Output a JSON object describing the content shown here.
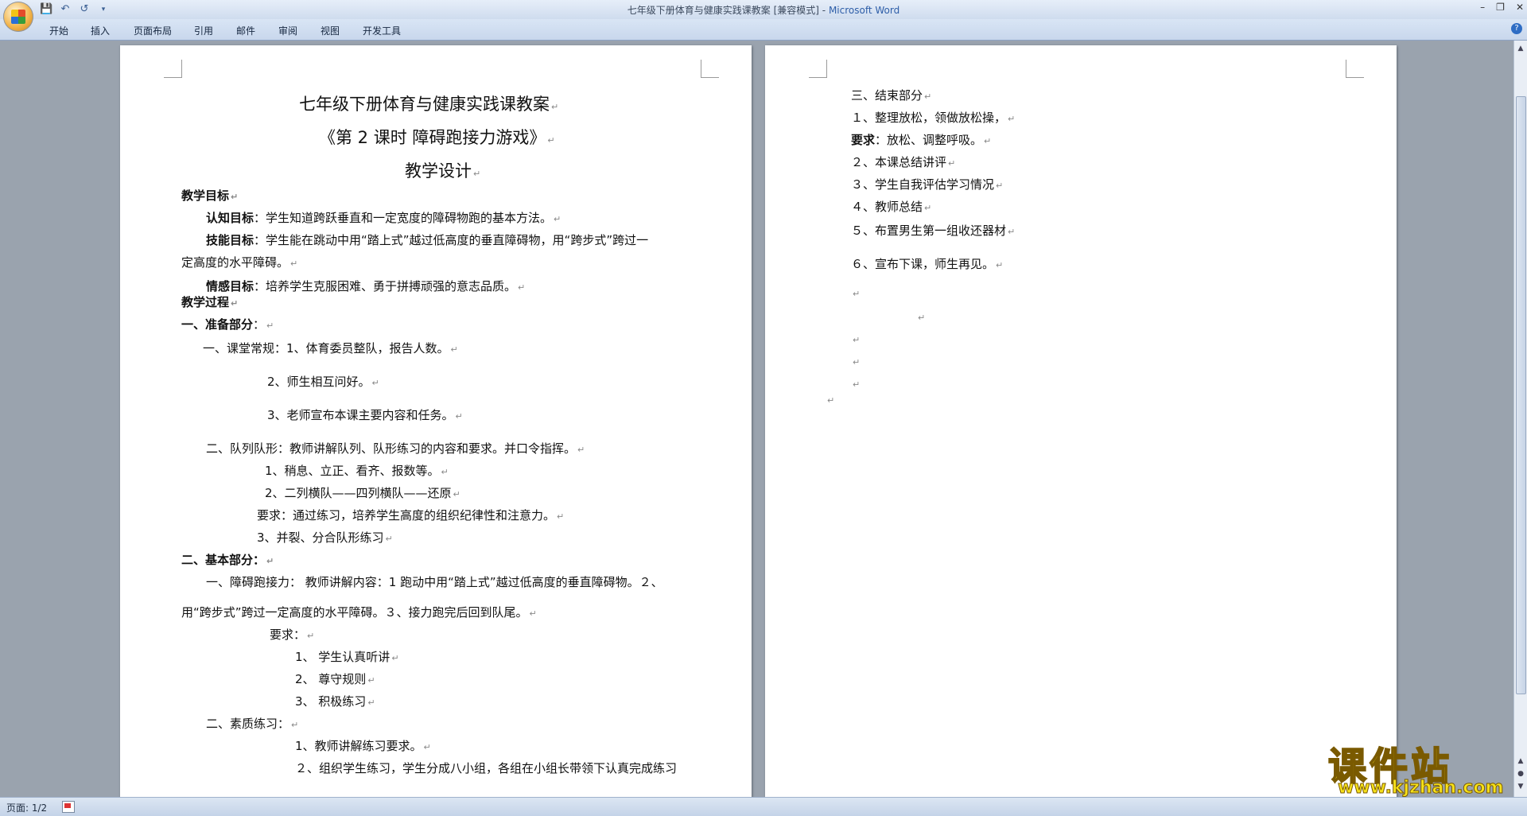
{
  "window": {
    "title": "七年级下册体育与健康实践课教案 [兼容模式]",
    "title_sep": " - ",
    "app_name": "Microsoft Word"
  },
  "quick_access": {
    "save_icon": "save-icon",
    "undo_icon": "undo-icon",
    "redo_icon": "redo-icon",
    "customize_icon": "customize-icon"
  },
  "ribbon": {
    "tabs": [
      "开始",
      "插入",
      "页面布局",
      "引用",
      "邮件",
      "审阅",
      "视图",
      "开发工具"
    ]
  },
  "page1": {
    "title": "七年级下册体育与健康实践课教案",
    "subtitle": "《第 2 课时  障碍跑接力游戏》",
    "subtitle2": "教学设计",
    "goal_heading": "教学目标",
    "cognitive_label": "认知目标",
    "cognitive_text": "：学生知道跨跃垂直和一定宽度的障碍物跑的基本方法。",
    "skill_label": "技能目标",
    "skill_text": "：学生能在跳动中用“踏上式”越过低高度的垂直障碍物，用“跨步式”跨过一",
    "skill_text2": "定高度的水平障碍。",
    "emotion_label": "情感目标",
    "emotion_text": "：培养学生克服困难、勇于拼搏顽强的意志品质。",
    "process_heading": "教学过程",
    "part1_heading": "一、准备部分",
    "part1_colon": "：",
    "routine": "一、课堂常规：1、体育委员整队，报告人数。",
    "routine2": "2、师生相互问好。",
    "routine3": "3、老师宣布本课主要内容和任务。",
    "formation": "二、队列队形：教师讲解队列、队形练习的内容和要求。并口令指挥。",
    "formation1": "1、稍息、立正、看齐、报数等。",
    "formation2": "2、二列横队——四列横队——还原",
    "formation_req": "要求：通过练习，培养学生高度的组织纪律性和注意力。",
    "formation3": "3、并裂、分合队形练习",
    "part2_heading": "二、基本部分：",
    "relay_line1": "一、障碍跑接力： 教师讲解内容：1 跑动中用“踏上式”越过低高度的垂直障碍物。２、",
    "relay_line2": "用“跨步式”跨过一定高度的水平障碍。３、接力跑完后回到队尾。",
    "req_label": "要求：",
    "req1": "1、 学生认真听讲",
    "req2": "2、 尊守规则",
    "req3": "3、 积极练习",
    "quality": "二、素质练习：",
    "quality1": "1、教师讲解练习要求。",
    "quality2": "２、组织学生练习，学生分成八小组，各组在小组长带领下认真完成练习"
  },
  "page2": {
    "end_heading": "三、结束部分",
    "item1": "１、整理放松，领做放松操，",
    "req_label": "要求",
    "req_text": "：放松、调整呼吸。",
    "item2": "２、本课总结讲评",
    "item3": "３、学生自我评估学习情况",
    "item4": "４、教师总结",
    "item5": "５、布置男生第一组收还器材",
    "item6": "６、宣布下课，师生再见。"
  },
  "paragraph_mark": "↵",
  "status": {
    "page_info": "页面: 1/2"
  },
  "watermark": {
    "text": "课件站",
    "url": "www.kjzhan.com"
  }
}
